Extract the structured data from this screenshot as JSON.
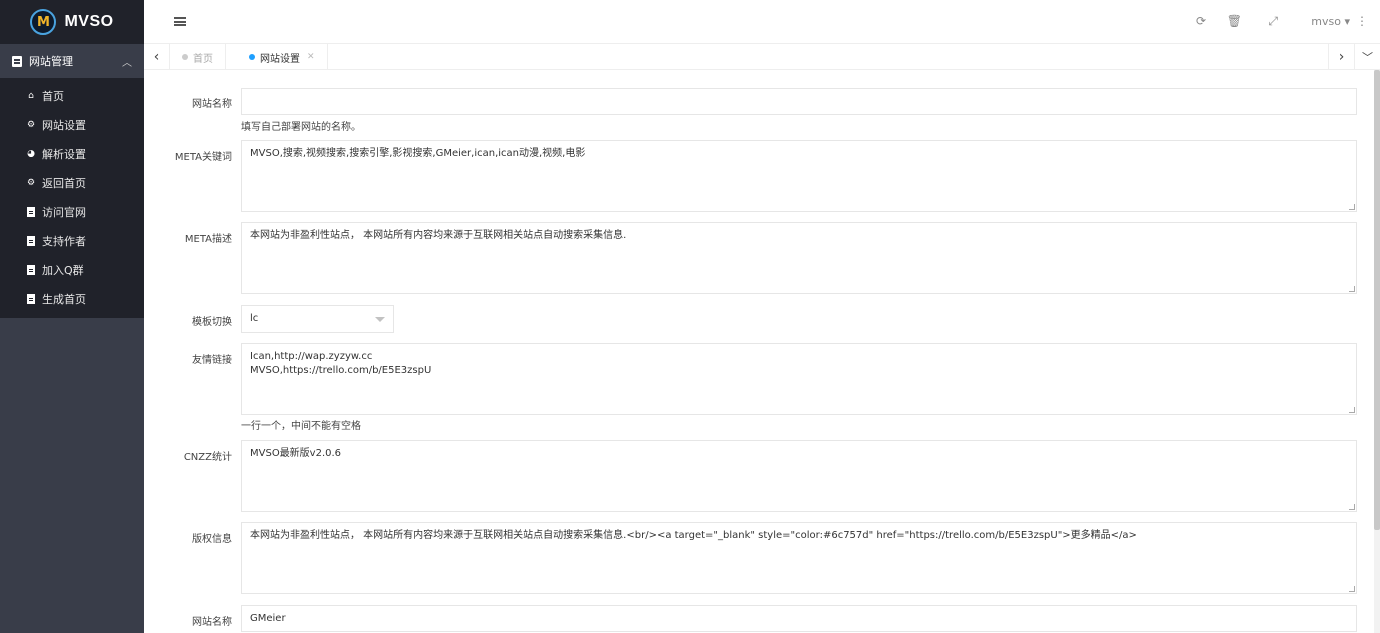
{
  "brand": {
    "name": "MVSO",
    "mark": "M"
  },
  "sidebar": {
    "group": {
      "label": "网站管理"
    },
    "items": [
      {
        "label": "首页",
        "icon": "home-icon",
        "glyph": "⌂"
      },
      {
        "label": "网站设置",
        "icon": "settings-icon",
        "glyph": "⚙"
      },
      {
        "label": "解析设置",
        "icon": "dashboard-icon",
        "glyph": "◕"
      },
      {
        "label": "返回首页",
        "icon": "gears-icon",
        "glyph": "⚙"
      },
      {
        "label": "访问官网",
        "icon": "document-icon"
      },
      {
        "label": "支持作者",
        "icon": "document-icon"
      },
      {
        "label": "加入Q群",
        "icon": "document-icon"
      },
      {
        "label": "生成首页",
        "icon": "document-icon"
      }
    ]
  },
  "header": {
    "user": "mvso",
    "icons": [
      "menu-toggle-icon",
      "refresh-icon",
      "trash-icon",
      "fullscreen-icon",
      "more-icon"
    ]
  },
  "tabs": [
    {
      "label": "首页",
      "active": false
    },
    {
      "label": "网站设置",
      "active": true
    }
  ],
  "form": {
    "site_name": {
      "label": "网站名称",
      "value": "",
      "help": "填写自己部署网站的名称。"
    },
    "meta_keywords": {
      "label": "META关键词",
      "value": "MVSO,搜索,视频搜索,搜索引擎,影视搜索,GMeier,ican,ican动漫,视频,电影"
    },
    "meta_desc": {
      "label": "META描述",
      "value": "本网站为非盈利性站点， 本网站所有内容均来源于互联网相关站点自动搜索采集信息."
    },
    "template": {
      "label": "模板切换",
      "value": "lc"
    },
    "friend_links": {
      "label": "友情链接",
      "lines": [
        "Ican,http://wap.zyzyw.cc",
        "MVSO,https://trello.com/b/E5E3zspU"
      ],
      "help": "一行一个，中间不能有空格"
    },
    "cnzz": {
      "label": "CNZZ统计",
      "value": "MVSO最新版v2.0.6"
    },
    "copyright": {
      "label": "版权信息",
      "value": "本网站为非盈利性站点， 本网站所有内容均来源于互联网相关站点自动搜索采集信息.<br/><a target=\"_blank\" style=\"color:#6c757d\" href=\"https://trello.com/b/E5E3zspU\">更多精品</a>"
    },
    "site_name2": {
      "label": "网站名称",
      "value": "GMeier"
    }
  }
}
